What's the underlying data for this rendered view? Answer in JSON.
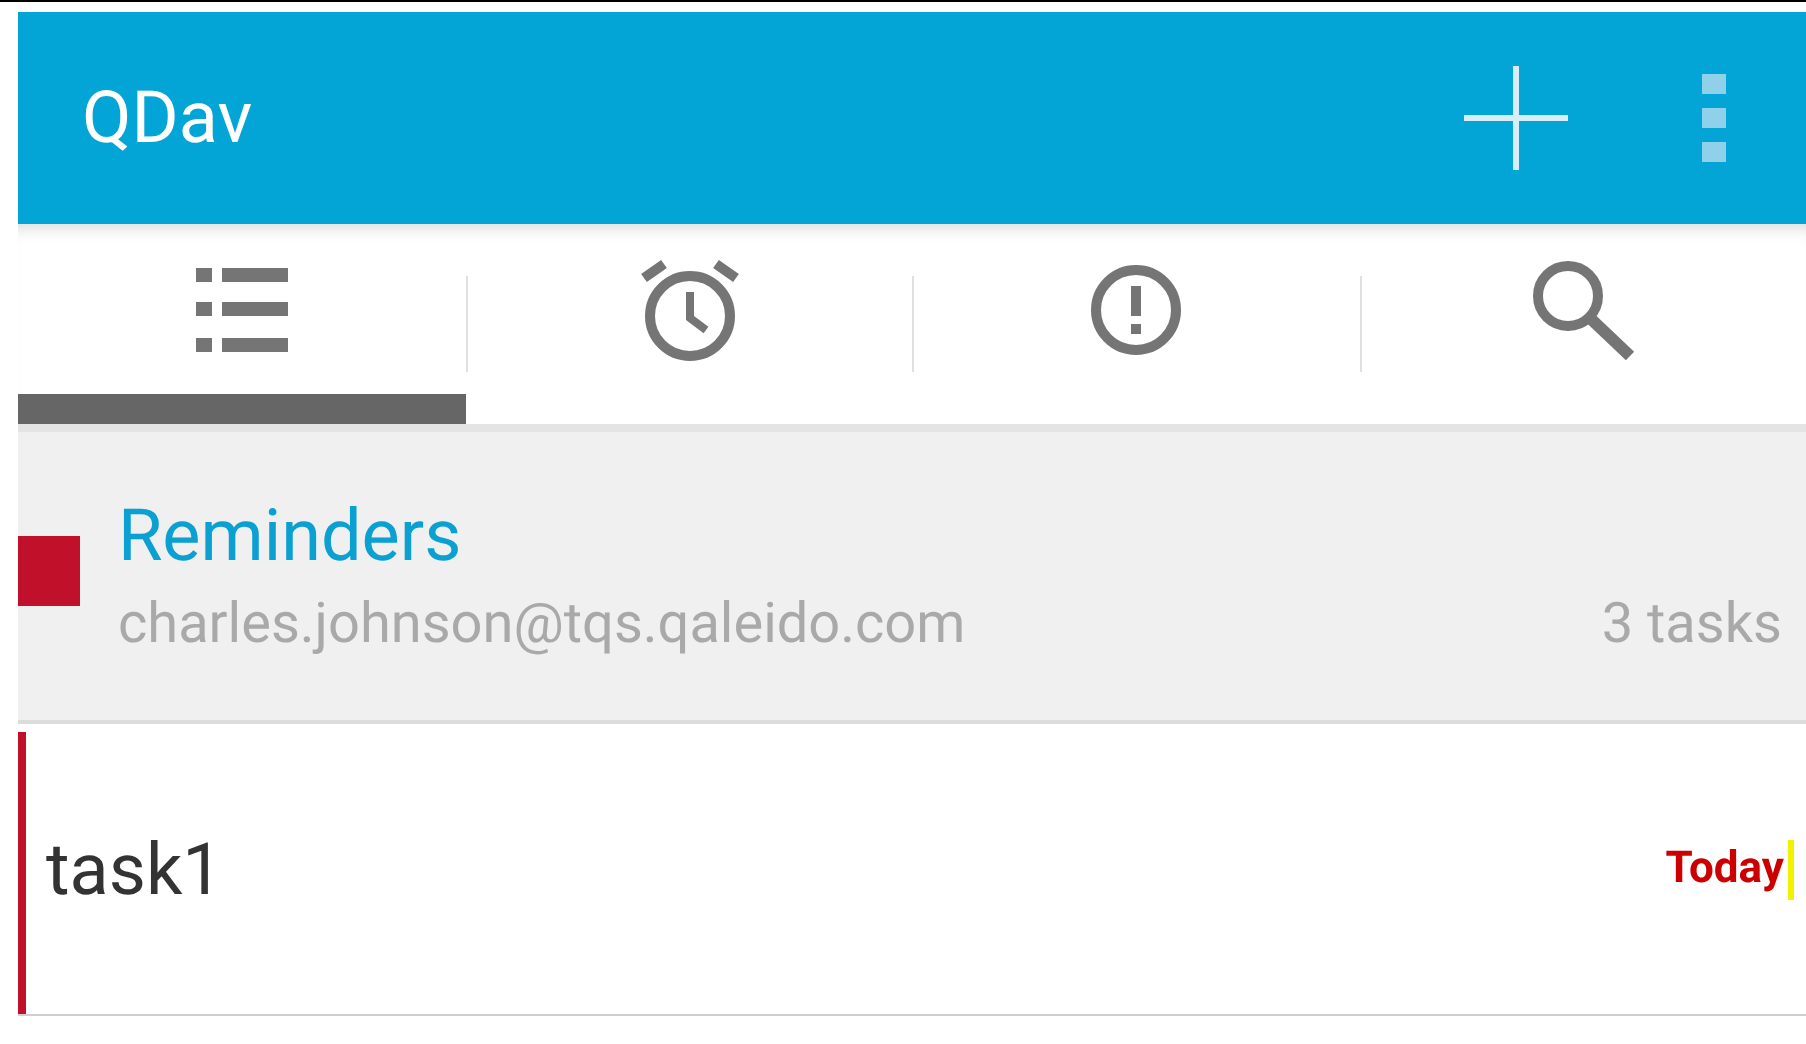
{
  "app_bar": {
    "title": "QDav"
  },
  "tabs": [
    {
      "kind": "list",
      "selected": true
    },
    {
      "kind": "alarm",
      "selected": false
    },
    {
      "kind": "alert",
      "selected": false
    },
    {
      "kind": "search",
      "selected": false
    }
  ],
  "list_header": {
    "title": "Reminders",
    "account": "charles.johnson@tqs.qaleido.com",
    "count": "3 tasks",
    "color": "#c0102a"
  },
  "tasks": [
    {
      "title": "task1",
      "due": "Today",
      "color": "#c0102a"
    }
  ]
}
